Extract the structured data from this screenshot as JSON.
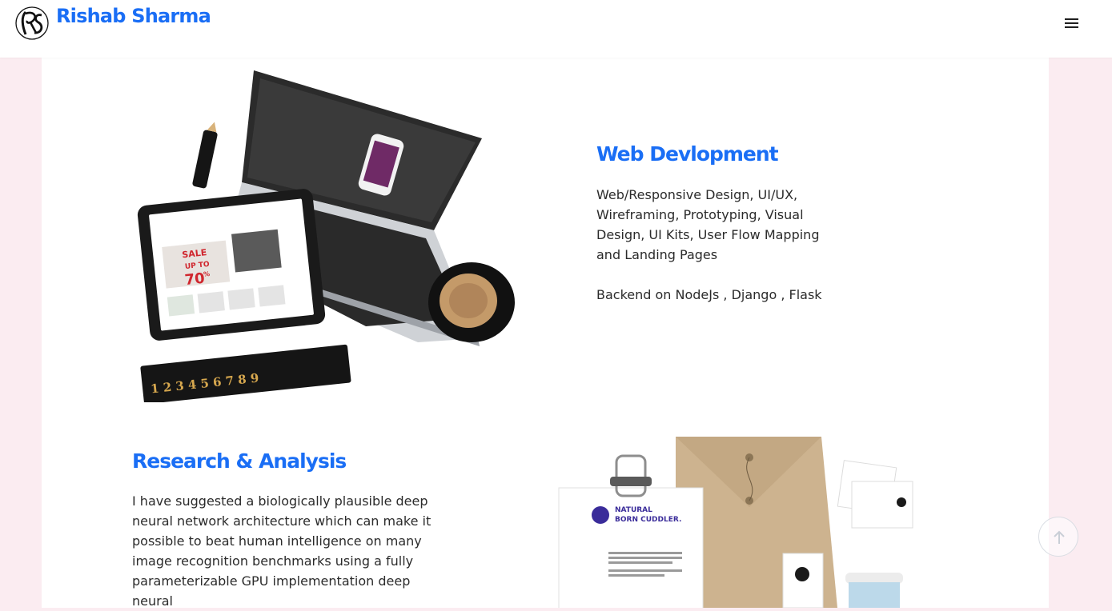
{
  "header": {
    "brand_name": "Rishab Sharma",
    "logo_icon": "rs-monogram-logo",
    "menu_icon": "hamburger-menu-icon"
  },
  "services": [
    {
      "title": "Web Devlopment",
      "description": "Web/Responsive Design, UI/UX, Wireframing, Prototyping, Visual Design, UI Kits, User Flow Mapping and Landing Pages",
      "extra": "Backend on NodeJs , Django , Flask",
      "illustration": "laptop-tablet-coffee-mockup"
    },
    {
      "title": "Research & Analysis",
      "description": "I have suggested a biologically plausible deep neural network architecture which can make it possible to beat human intelligence on many image recognition benchmarks using a fully parameterizable GPU implementation deep neural",
      "illustration": "stationery-branding-mockup"
    }
  ],
  "mockup_text": {
    "sale_label": "SALE",
    "sale_up_to": "UP TO",
    "sale_value": "70",
    "sale_unit": "%",
    "ruler_numbers": [
      "1",
      "2",
      "3",
      "4",
      "5",
      "6",
      "7",
      "8",
      "9"
    ],
    "brand_line_1": "NATURAL",
    "brand_line_2": "BORN CUDDLER."
  },
  "colors": {
    "accent": "#1a6ef5",
    "page_background": "#fbecf1",
    "card_background": "#ffffff",
    "body_text": "#2b2b2b"
  },
  "back_to_top": {
    "icon": "arrow-up-icon"
  }
}
